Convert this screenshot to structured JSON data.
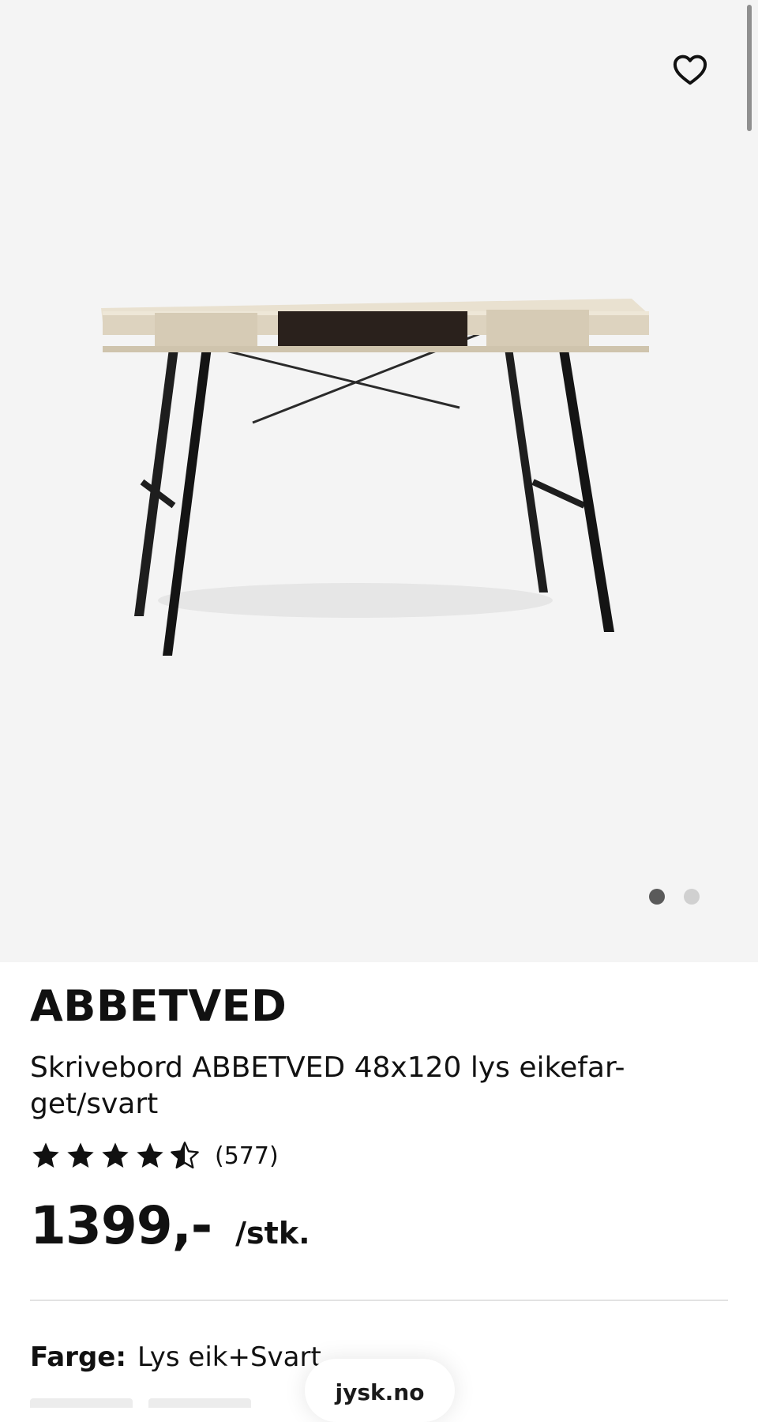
{
  "product": {
    "brand": "ABBETVED",
    "description": "Skrivebord ABBETVED 48x120 lys eikefar-get/svart",
    "rating": 4.5,
    "rating_max": 5,
    "review_count": "(577)",
    "price": "1399,-",
    "unit": "/stk.",
    "color_label": "Farge:",
    "color_value": "Lys eik+Svart"
  },
  "gallery": {
    "image_count": 2,
    "active_index": 0
  },
  "browser": {
    "domain": "jysk.no"
  },
  "icons": {
    "wishlist": "heart-outline-icon",
    "star": "star-icon"
  },
  "colors": {
    "gallery_bg": "#f4f4f4",
    "text": "#111111",
    "dot_active": "#5a5a5a",
    "dot_inactive": "#d0d0d0"
  }
}
